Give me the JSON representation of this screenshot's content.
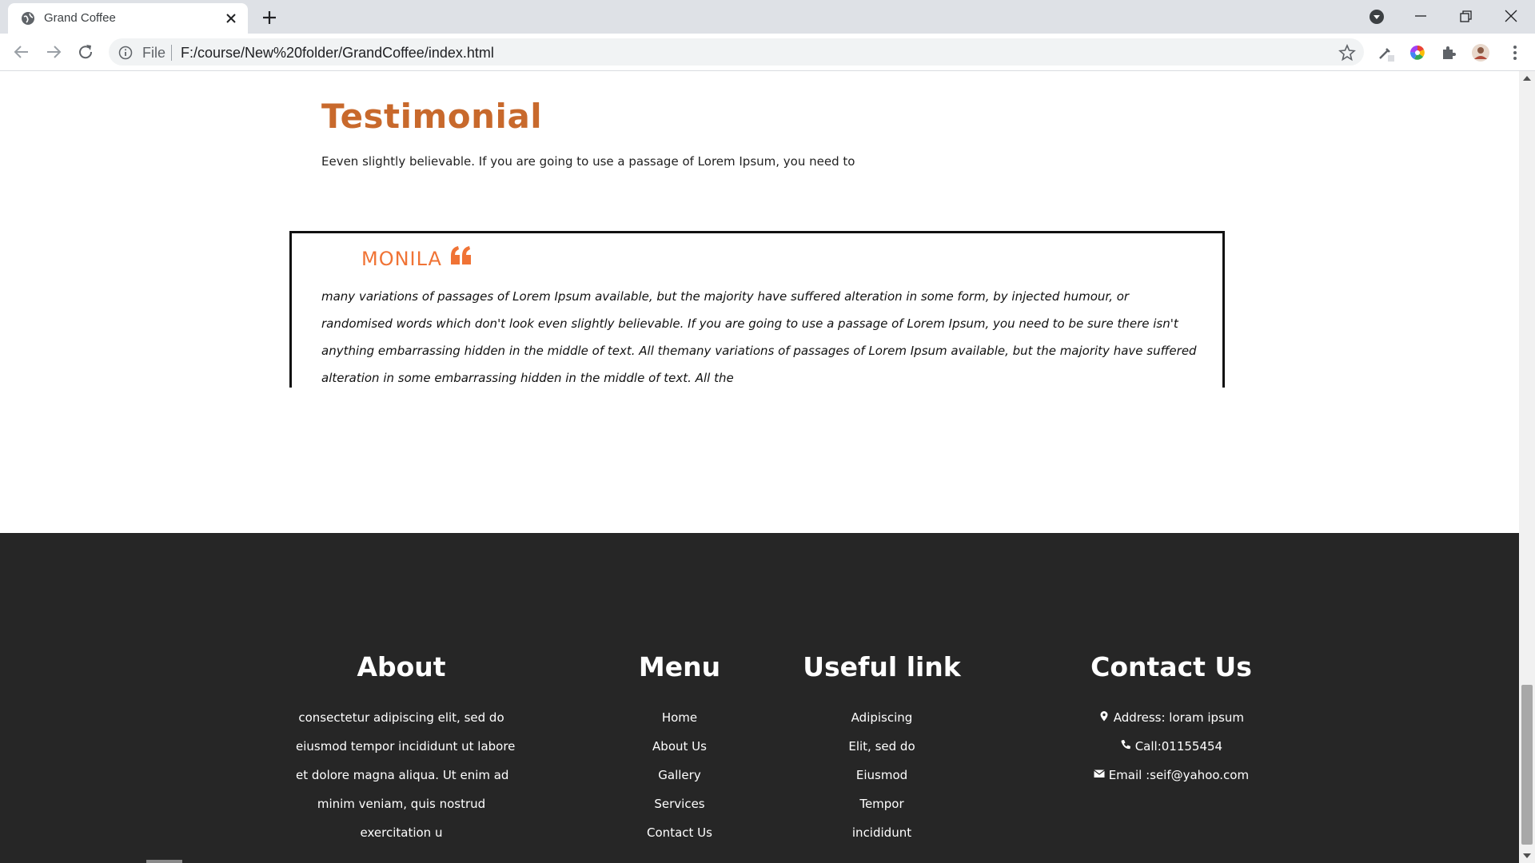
{
  "browser": {
    "tab_title": "Grand Coffee",
    "file_label": "File",
    "url": "F:/course/New%20folder/GrandCoffee/index.html"
  },
  "testimonial": {
    "title": "Testimonial",
    "subtitle": "Eeven slightly believable. If you are going to use a passage of Lorem Ipsum, you need to",
    "name": "MONILA",
    "quote": "many variations of passages of Lorem Ipsum available, but the majority have suffered alteration in some form, by injected humour, or randomised words which don't look even slightly believable. If you are going to use a passage of Lorem Ipsum, you need to be sure there isn't anything embarrassing hidden in the middle of text. All themany variations of passages of Lorem Ipsum available, but the majority have suffered alteration in some embarrassing hidden in the middle of text. All the"
  },
  "footer": {
    "about": {
      "heading": "About",
      "lines": [
        "consectetur adipiscing elit, sed do",
        "eiusmod tempor incididunt ut labore",
        "et dolore magna aliqua. Ut enim ad",
        "minim veniam, quis nostrud",
        "exercitation u"
      ]
    },
    "menu": {
      "heading": "Menu",
      "items": [
        "Home",
        "About Us",
        "Gallery",
        "Services",
        "Contact Us"
      ]
    },
    "useful": {
      "heading": "Useful link",
      "items": [
        "Adipiscing",
        "Elit, sed do",
        "Eiusmod",
        "Tempor",
        "incididunt"
      ]
    },
    "contact": {
      "heading": "Contact Us",
      "address": "Address: loram ipsum",
      "phone": "Call:01155454",
      "email": "Email :seif@yahoo.com"
    }
  },
  "colors": {
    "accent": "#c8692c",
    "name_orange": "#f07335",
    "footer_bg": "#262626"
  }
}
